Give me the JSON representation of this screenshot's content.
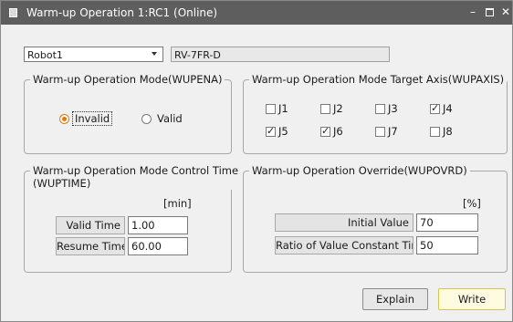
{
  "window": {
    "title": "Warm-up Operation 1:RC1 (Online)"
  },
  "robot": {
    "selected": "Robot1",
    "model": "RV-7FR-D"
  },
  "mode_group": {
    "title": "Warm-up Operation Mode(WUPENA)",
    "options": [
      {
        "label": "Invalid",
        "selected": true
      },
      {
        "label": "Valid",
        "selected": false
      }
    ]
  },
  "axis_group": {
    "title": "Warm-up Operation Mode Target Axis(WUPAXIS)",
    "axes": [
      {
        "label": "J1",
        "checked": false
      },
      {
        "label": "J2",
        "checked": false
      },
      {
        "label": "J3",
        "checked": false
      },
      {
        "label": "J4",
        "checked": true
      },
      {
        "label": "J5",
        "checked": true
      },
      {
        "label": "J6",
        "checked": true
      },
      {
        "label": "J7",
        "checked": false
      },
      {
        "label": "J8",
        "checked": false
      }
    ]
  },
  "time_group": {
    "title_line1": "Warm-up Operation Mode Control Time",
    "title_line2": "(WUPTIME)",
    "unit": "[min]",
    "valid_time_label": "Valid Time",
    "valid_time_value": "1.00",
    "resume_time_label": "Resume Time",
    "resume_time_value": "60.00"
  },
  "override_group": {
    "title": "Warm-up Operation Override(WUPOVRD)",
    "unit": "[%]",
    "initial_value_label": "Initial Value",
    "initial_value": "70",
    "ratio_label": "Ratio of Value Constant Time",
    "ratio_value": "50"
  },
  "buttons": {
    "explain": "Explain",
    "write": "Write"
  }
}
